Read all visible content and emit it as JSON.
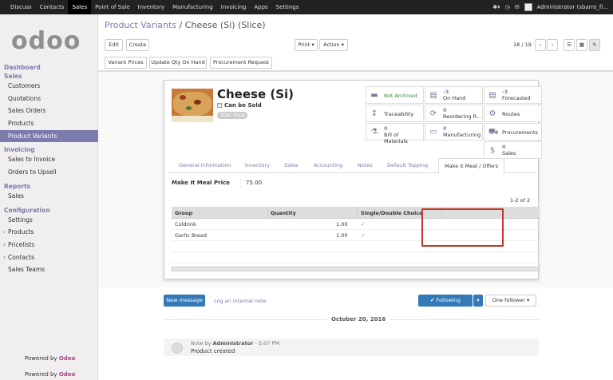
{
  "topbar": {
    "menu": [
      "Discuss",
      "Contacts",
      "Sales",
      "Point of Sale",
      "Inventory",
      "Manufacturing",
      "Invoicing",
      "Apps",
      "Settings"
    ],
    "active": "Sales",
    "user": "Administrator (sbarro_fi..."
  },
  "sidebar": {
    "logo": "odoo",
    "sections": [
      {
        "title": "Dashboard",
        "items": []
      },
      {
        "title": "Sales",
        "items": [
          "Customers",
          "Quotations",
          "Sales Orders",
          "Products",
          "Product Variants"
        ]
      },
      {
        "title": "Invoicing",
        "items": [
          "Sales to Invoice",
          "Orders to Upsell"
        ]
      },
      {
        "title": "Reports",
        "items": [
          "Sales"
        ]
      },
      {
        "title": "Configuration",
        "items": [
          "Settings",
          "Products",
          "Pricelists",
          "Contacts",
          "Sales Teams"
        ]
      }
    ],
    "active_item": "Product Variants",
    "powered_prefix": "Powered by",
    "powered_brand": "Odoo"
  },
  "breadcrumb": {
    "parent": "Product Variants",
    "separator": "/",
    "current": "Cheese (Si) (Slice)"
  },
  "toolbar": {
    "edit": "Edit",
    "create": "Create",
    "print": "Print ▾",
    "action": "Action ▾",
    "pager": "18 / 19"
  },
  "actions": [
    "Variant Prices",
    "Update Qty On Hand",
    "Procurement Request"
  ],
  "product": {
    "name": "Cheese (Si)",
    "can_be_sold": "Can be Sold",
    "variant_tag": "Size: Slice"
  },
  "stats": [
    {
      "num": "",
      "label": "Not Archived"
    },
    {
      "num": "-3",
      "label": "On Hand"
    },
    {
      "num": "-3",
      "label": "Forecasted"
    },
    {
      "num": "",
      "label": "Traceability"
    },
    {
      "num": "0",
      "label": "Reordering R..."
    },
    {
      "num": "",
      "label": "Routes"
    },
    {
      "num": "0",
      "label": "Bill of Materials"
    },
    {
      "num": "0",
      "label": "Manufacturing"
    },
    {
      "num": "",
      "label": "Procurements"
    },
    {
      "num": "0",
      "label": "Sales"
    }
  ],
  "tabs": [
    "General Information",
    "Inventory",
    "Sales",
    "Accounting",
    "Notes",
    "Default Topping",
    "Make it Meal / Offers"
  ],
  "active_tab": "Make it Meal / Offers",
  "meal_price": {
    "label": "Make It Meal Price",
    "value": "75.00"
  },
  "record_count": "1-2 of 2",
  "table": {
    "headers": [
      "Group",
      "Quantity",
      "Single/Double Choice"
    ],
    "rows": [
      {
        "group": "Coldrink",
        "quantity": "1.00",
        "choice": "✓"
      },
      {
        "group": "Garlic Bread",
        "quantity": "1.00",
        "choice": "✓"
      }
    ]
  },
  "chatter": {
    "new_message": "New message",
    "log_note": "Log an internal note",
    "following": "✔ Following",
    "followers": "One follower ▾",
    "date": "October 20, 2016",
    "note_prefix": "Note by",
    "author": "Administrator",
    "time": "- 5:07 PM",
    "body": "Product created"
  },
  "colors": {
    "accent": "#7c7bad",
    "topbar": "#222222",
    "primary": "#337ab7",
    "highlight": "#c0392b"
  }
}
